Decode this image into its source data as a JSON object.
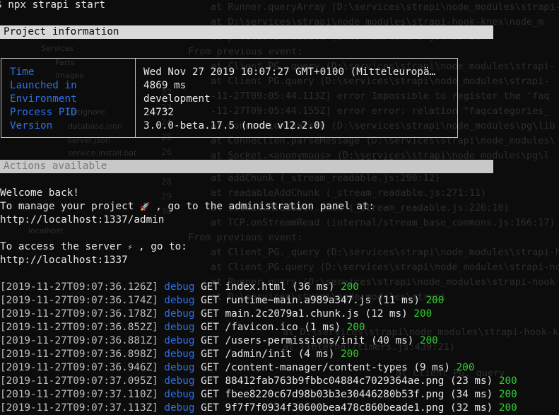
{
  "prompt": {
    "symbol": "$",
    "command": "npx strapi start"
  },
  "project_info": {
    "header": "Project information",
    "rows": [
      {
        "key": "Time",
        "value": "Wed Nov 27 2019 10:07:27 GMT+0100 (Mitteleuropä…"
      },
      {
        "key": "Launched in",
        "value": "4869 ms"
      },
      {
        "key": "Environment",
        "value": "development"
      },
      {
        "key": "Process PID",
        "value": "24732"
      },
      {
        "key": "Version",
        "value": "3.0.0-beta.17.5 (node v12.2.0)"
      }
    ]
  },
  "actions": {
    "header": "Actions available",
    "welcome": "Welcome back!",
    "admin_text_before": "To manage your project",
    "admin_icon": "rocket-icon",
    "admin_glyph": "🚀",
    "admin_text_after": ", go to the administration panel at:",
    "admin_url": "http://localhost:1337/admin",
    "server_text_before": "To access the server",
    "server_icon": "lightning-icon",
    "server_glyph": "⚡",
    "server_text_after": ", go to:",
    "server_url": "http://localhost:1337"
  },
  "logs": [
    {
      "timestamp": "[2019-11-27T09:07:36.126Z]",
      "level": "debug",
      "method": "GET",
      "path": "index.html",
      "duration": "(36 ms)",
      "status": "200"
    },
    {
      "timestamp": "[2019-11-27T09:07:36.174Z]",
      "level": "debug",
      "method": "GET",
      "path": "runtime~main.a989a347.js",
      "duration": "(11 ms)",
      "status": "200"
    },
    {
      "timestamp": "[2019-11-27T09:07:36.178Z]",
      "level": "debug",
      "method": "GET",
      "path": "main.2c2079a1.chunk.js",
      "duration": "(12 ms)",
      "status": "200"
    },
    {
      "timestamp": "[2019-11-27T09:07:36.852Z]",
      "level": "debug",
      "method": "GET",
      "path": "/favicon.ico",
      "duration": "(1 ms)",
      "status": "200"
    },
    {
      "timestamp": "[2019-11-27T09:07:36.881Z]",
      "level": "debug",
      "method": "GET",
      "path": "/users-permissions/init",
      "duration": "(40 ms)",
      "status": "200"
    },
    {
      "timestamp": "[2019-11-27T09:07:36.898Z]",
      "level": "debug",
      "method": "GET",
      "path": "/admin/init",
      "duration": "(4 ms)",
      "status": "200"
    },
    {
      "timestamp": "[2019-11-27T09:07:36.946Z]",
      "level": "debug",
      "method": "GET",
      "path": "/content-manager/content-types",
      "duration": "(9 ms)",
      "status": "200"
    },
    {
      "timestamp": "[2019-11-27T09:07:37.095Z]",
      "level": "debug",
      "method": "GET",
      "path": "88412fab763b9fbbc04884c7029364ae.png",
      "duration": "(23 ms)",
      "status": "200"
    },
    {
      "timestamp": "[2019-11-27T09:07:37.110Z]",
      "level": "debug",
      "method": "GET",
      "path": "fbee8220c67d98b03b3e30446280b53f.png",
      "duration": "(34 ms)",
      "status": "200"
    },
    {
      "timestamp": "[2019-11-27T09:07:37.113Z]",
      "level": "debug",
      "method": "GET",
      "path": "9f7f7f0934f30600bea478c860beade1.png",
      "duration": "(32 ms)",
      "status": "200"
    }
  ],
  "colors": {
    "background": "#0c0c0c",
    "key_blue": "#2f6fe6",
    "status_green": "#2fd12f",
    "header_bar": "#d9d9d9"
  }
}
